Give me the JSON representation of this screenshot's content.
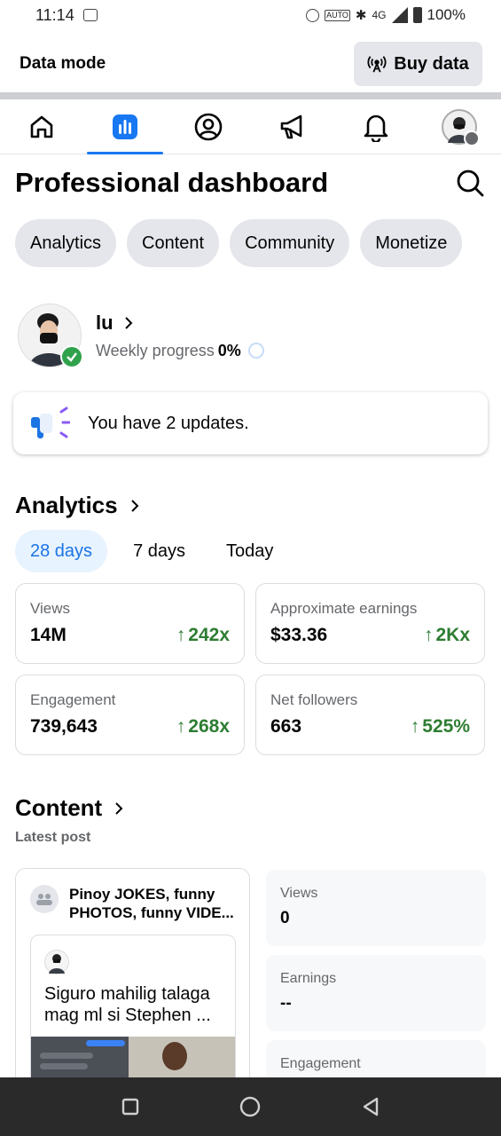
{
  "status_bar": {
    "time": "11:14",
    "network": "4G",
    "battery": "100%",
    "auto_label": "AUTO"
  },
  "data_mode": {
    "title": "Data mode",
    "buy_label": "Buy data"
  },
  "nav": {
    "items": [
      "home",
      "dashboard",
      "profile",
      "ads",
      "notifications",
      "account"
    ],
    "active": "dashboard"
  },
  "page": {
    "title": "Professional dashboard"
  },
  "chips": [
    "Analytics",
    "Content",
    "Community",
    "Monetize"
  ],
  "profile": {
    "name": "lu",
    "weekly_label": "Weekly progress",
    "weekly_value": "0%"
  },
  "updates": {
    "text": "You have 2 updates."
  },
  "analytics": {
    "title": "Analytics",
    "ranges": [
      "28 days",
      "7 days",
      "Today"
    ],
    "active_range": "28 days",
    "cards": [
      {
        "label": "Views",
        "value": "14M",
        "change": "242x"
      },
      {
        "label": "Approximate earnings",
        "value": "$33.36",
        "change": "2Kx"
      },
      {
        "label": "Engagement",
        "value": "739,643",
        "change": "268x"
      },
      {
        "label": "Net followers",
        "value": "663",
        "change": "525%"
      }
    ]
  },
  "content": {
    "title": "Content",
    "latest_label": "Latest post",
    "post": {
      "group": "Pinoy JOKES, funny PHOTOS, funny VIDE...",
      "text": "Siguro mahilig talaga mag ml si Stephen ..."
    },
    "stats": [
      {
        "label": "Views",
        "value": "0"
      },
      {
        "label": "Earnings",
        "value": "--"
      },
      {
        "label": "Engagement",
        "value": ""
      }
    ]
  },
  "colors": {
    "accent": "#1877f2",
    "positive": "#2e7d32",
    "chip_bg": "#e4e6eb"
  }
}
